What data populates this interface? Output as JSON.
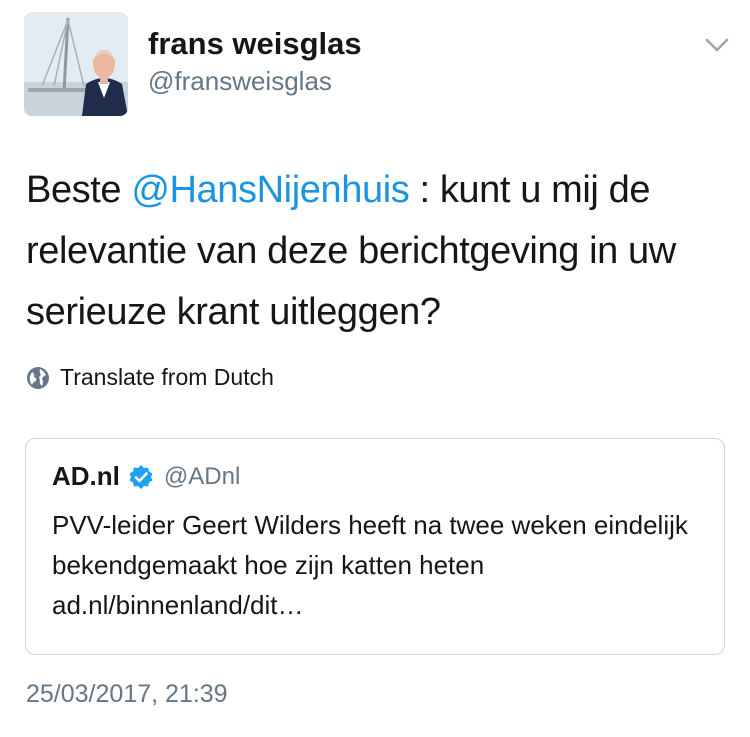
{
  "author": {
    "display_name": "frans weisglas",
    "handle": "@fransweisglas"
  },
  "tweet": {
    "text_before": "Beste ",
    "mention": "@HansNijenhuis",
    "text_after": " : kunt u mij de relevantie van deze berichtgeving in uw serieuze krant uitleggen?",
    "translate_label": "Translate from Dutch",
    "timestamp": "25/03/2017, 21:39"
  },
  "quoted_tweet": {
    "name": "AD.nl",
    "handle": "@ADnl",
    "text": "PVV-leider Geert Wilders heeft na twee weken eindelijk bekendgemaakt hoe zijn katten heten ad.nl/binnenland/dit…"
  },
  "icons": {
    "menu": "chevron-down-icon",
    "translate": "globe-icon",
    "verified": "verified-badge-icon"
  },
  "colors": {
    "link": "#1b95e0",
    "secondary_text": "#657786",
    "border": "#ccd6dd"
  }
}
